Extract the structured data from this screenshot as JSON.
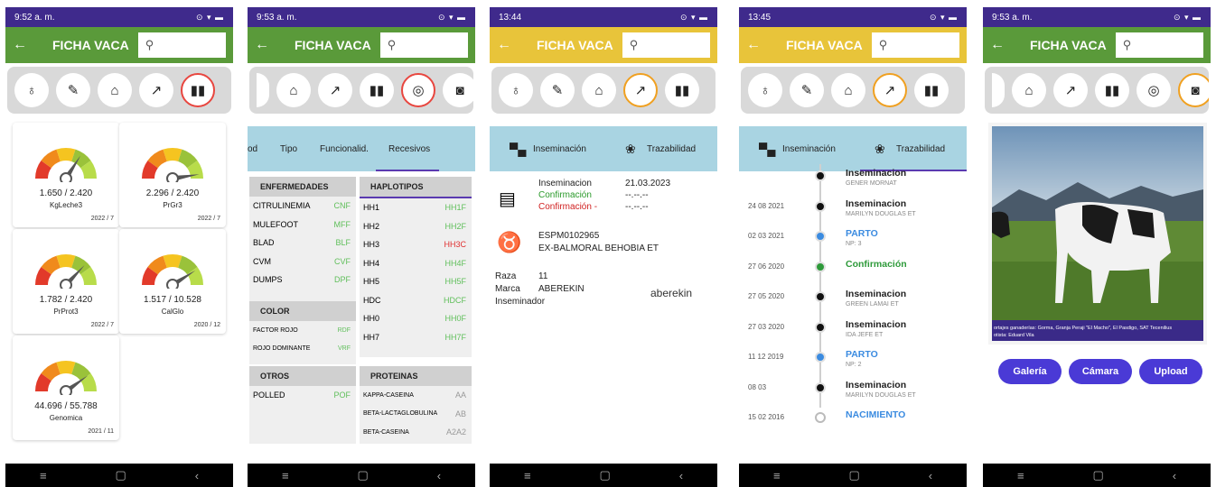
{
  "colors": {
    "status_bar": "#3f2a8c",
    "green_bar": "#5a9a3a",
    "yellow_bar": "#e8c43a",
    "tab_bg": "#a9d4e2",
    "button": "#4a3ad6"
  },
  "screens": [
    {
      "time": "9:52 a. m.",
      "title": "FICHA VACA",
      "gauges": [
        {
          "value": "1.650 / 2.420",
          "label": "KgLeche3",
          "date": "2022 / 7",
          "level": 0.68
        },
        {
          "value": "2.296 / 2.420",
          "label": "PrGr3",
          "date": "2022 / 7",
          "level": 0.95
        },
        {
          "value": "1.782 / 2.420",
          "label": "PrProt3",
          "date": "2022 / 7",
          "level": 0.74
        },
        {
          "value": "1.517 / 10.528",
          "label": "CalGlo",
          "date": "2020 / 12",
          "level": 0.82
        },
        {
          "value": "44.696 / 55.788",
          "label": "Genomica",
          "date": "2021 / 11",
          "level": 0.8
        }
      ]
    },
    {
      "time": "9:53 a. m.",
      "title": "FICHA VACA",
      "tabs": [
        "od",
        "Tipo",
        "Funcionalid.",
        "Recesivos"
      ],
      "enfermedades_head": "ENFERMEDADES",
      "haplotipos_head": "HAPLOTIPOS",
      "enfermedades": [
        {
          "name": "CITRULINEMIA",
          "code": "CNF"
        },
        {
          "name": "MULEFOOT",
          "code": "MFF"
        },
        {
          "name": "BLAD",
          "code": "BLF"
        },
        {
          "name": "CVM",
          "code": "CVF"
        },
        {
          "name": "DUMPS",
          "code": "DPF"
        }
      ],
      "haplotipos": [
        {
          "name": "HH1",
          "code": "HH1F"
        },
        {
          "name": "HH2",
          "code": "HH2F"
        },
        {
          "name": "HH3",
          "code": "HH3C"
        },
        {
          "name": "HH4",
          "code": "HH4F"
        },
        {
          "name": "HH5",
          "code": "HH5F"
        },
        {
          "name": "HDC",
          "code": "HDCF"
        },
        {
          "name": "HH0",
          "code": "HH0F"
        },
        {
          "name": "HH7",
          "code": "HH7F"
        }
      ],
      "color_head": "COLOR",
      "colores": [
        {
          "name": "FACTOR ROJO",
          "code": "RDF"
        },
        {
          "name": "ROJO DOMINANTE",
          "code": "VRF"
        }
      ],
      "otros_head": "OTROS",
      "otros": [
        {
          "name": "POLLED",
          "code": "POF"
        }
      ],
      "proteinas_head": "PROTEINAS",
      "proteinas": [
        {
          "name": "KAPPA-CASEINA",
          "code": "AA"
        },
        {
          "name": "BETA-LACTAGLOBULINA",
          "code": "AB"
        },
        {
          "name": "BETA-CASEINA",
          "code": "A2A2"
        }
      ]
    },
    {
      "time": "13:44",
      "title": "FICHA VACA",
      "tabs": [
        "Inseminación",
        "Trazabilidad"
      ],
      "inseminacion_label": "Inseminacion",
      "inseminacion_date": "21.03.2023",
      "confirmacion_pos_label": "Confirmación",
      "confirmacion_pos_date": "--.--.--",
      "confirmacion_neg_label": "Confirmación -",
      "confirmacion_neg_date": "--.--.--",
      "bull_code": "ESPM0102965",
      "bull_name": "EX-BALMORAL BEHOBIA ET",
      "raza_label": "Raza",
      "raza_value": "11",
      "marca_label": "Marca",
      "marca_value": "ABEREKIN",
      "inseminador_label": "Inseminador",
      "brand_logo": "aberekin"
    },
    {
      "time": "13:45",
      "title": "FICHA VACA",
      "tabs": [
        "Inseminación",
        "Trazabilidad"
      ],
      "timeline": [
        {
          "date": "",
          "title": "Inseminacion",
          "sub": "GENER MORNAT",
          "kind": "black"
        },
        {
          "date": "24 08 2021",
          "title": "Inseminacion",
          "sub": "MARILYN DOUGLAS ET",
          "kind": "black"
        },
        {
          "date": "02 03 2021",
          "title": "PARTO",
          "sub": "NP: 3",
          "kind": "blue"
        },
        {
          "date": "27 06 2020",
          "title": "Confirmación",
          "sub": "",
          "kind": "green"
        },
        {
          "date": "27 05 2020",
          "title": "Inseminacion",
          "sub": "GREEN LAMAI ET",
          "kind": "black"
        },
        {
          "date": "27 03 2020",
          "title": "Inseminacion",
          "sub": "IDA JEFE ET",
          "kind": "black"
        },
        {
          "date": "11 12 2019",
          "title": "PARTO",
          "sub": "NP: 2",
          "kind": "blue"
        },
        {
          "date": "08 03",
          "title": "Inseminacion",
          "sub": "MARILYN DOUGLAS ET",
          "kind": "black"
        },
        {
          "date": "15 02 2016",
          "title": "NACIMIENTO",
          "sub": "",
          "kind": "hollow"
        }
      ]
    },
    {
      "time": "9:53 a. m.",
      "title": "FICHA VACA",
      "photo_caption_1": "ortajes ganaderías: Gorma, Granja Peraji \"El Macho\", El Pasdigo, SAT Tecenilius",
      "photo_caption_2": "otista: Eduard Vila",
      "buttons": [
        "Galería",
        "Cámara",
        "Upload"
      ]
    }
  ]
}
